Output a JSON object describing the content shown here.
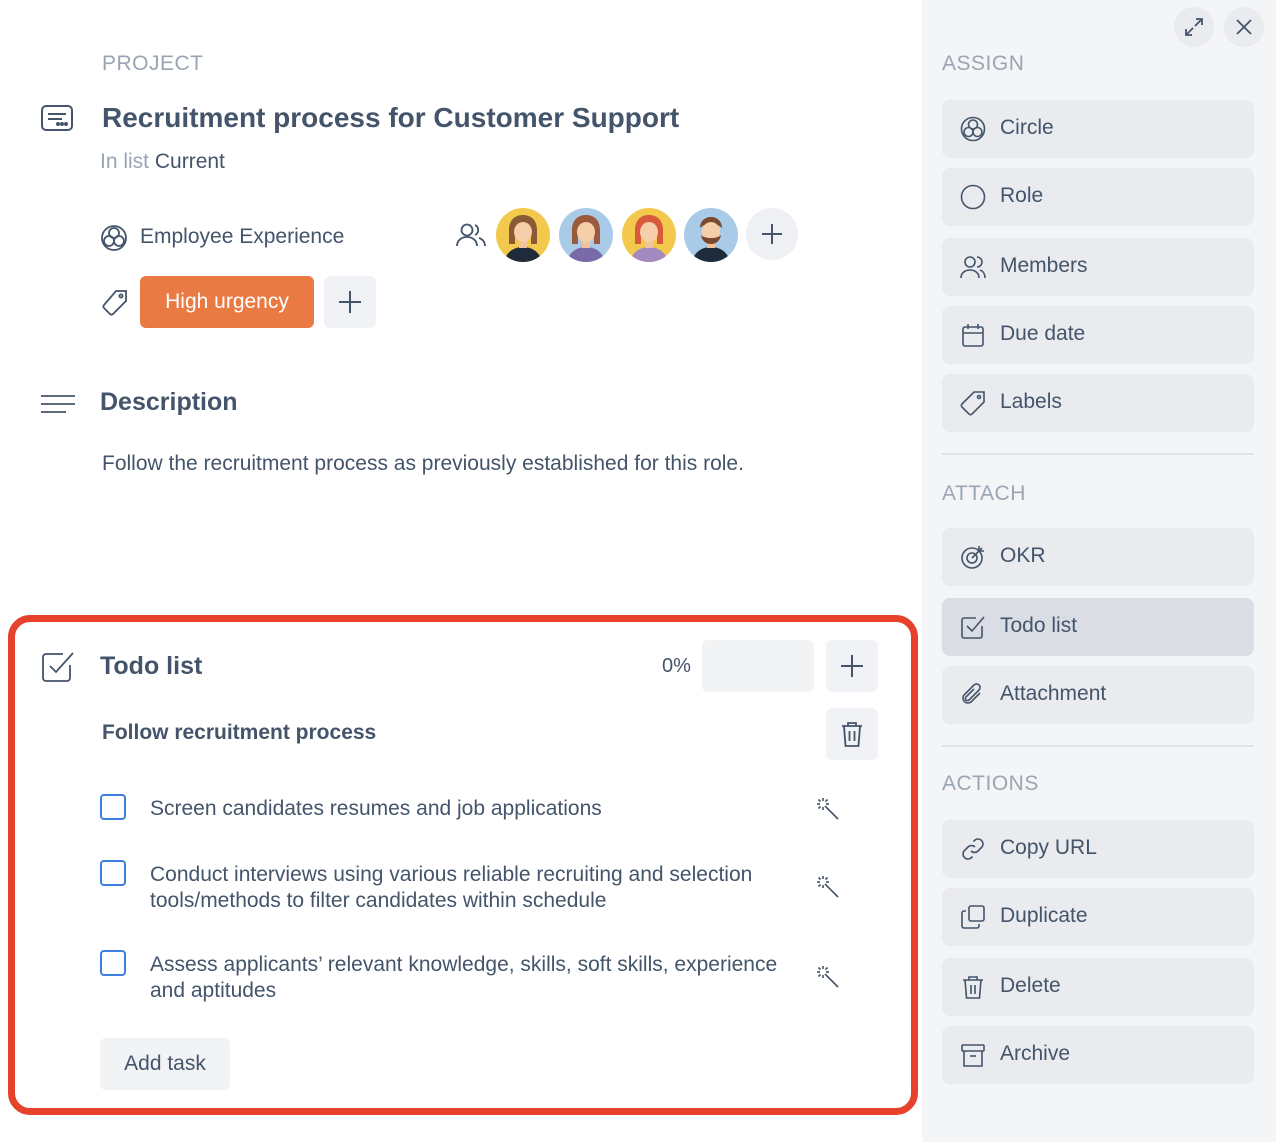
{
  "card": {
    "kicker": "PROJECT",
    "title": "Recruitment process for Customer Support",
    "in_list_prefix": "In list",
    "in_list_value": "Current",
    "circle_name": "Employee Experience",
    "label": "High urgency",
    "label_color": "#e97a43"
  },
  "members": [
    {
      "name": "member-1",
      "bg": "#f3c94d",
      "hair": "#8a5a34",
      "shirt": "#1f2a3a"
    },
    {
      "name": "member-2",
      "bg": "#a9cbe8",
      "hair": "#9c5a3c",
      "shirt": "#7a69a8"
    },
    {
      "name": "member-3",
      "bg": "#f3c94d",
      "hair": "#d9593b",
      "shirt": "#a08ac0"
    },
    {
      "name": "member-4",
      "bg": "#a9cbe8",
      "hair": "#7a4a2e",
      "shirt": "#1f2a3a"
    }
  ],
  "description": {
    "heading": "Description",
    "text": "Follow the recruitment process as previously established for this role."
  },
  "todo": {
    "heading": "Todo list",
    "progress_text": "0%",
    "progress_value": 0,
    "checklist_name": "Follow recruitment process",
    "tasks": [
      {
        "text": "Screen candidates resumes and job applications",
        "checked": false
      },
      {
        "text": "Conduct interviews using various reliable recruiting and selection tools/methods to filter candidates within schedule",
        "checked": false
      },
      {
        "text": "Assess applicants’ relevant knowledge, skills, soft skills, experience and aptitudes",
        "checked": false
      }
    ],
    "add_task_label": "Add task"
  },
  "sidebar": {
    "assign_heading": "ASSIGN",
    "assign": [
      {
        "label": "Circle",
        "icon": "circle-group-icon"
      },
      {
        "label": "Role",
        "icon": "role-icon"
      },
      {
        "label": "Members",
        "icon": "members-icon"
      },
      {
        "label": "Due date",
        "icon": "calendar-icon"
      },
      {
        "label": "Labels",
        "icon": "tag-icon"
      }
    ],
    "attach_heading": "ATTACH",
    "attach": [
      {
        "label": "OKR",
        "icon": "target-icon"
      },
      {
        "label": "Todo list",
        "icon": "checkbox-icon",
        "active": true
      },
      {
        "label": "Attachment",
        "icon": "paperclip-icon"
      }
    ],
    "actions_heading": "ACTIONS",
    "actions": [
      {
        "label": "Copy URL",
        "icon": "link-icon"
      },
      {
        "label": "Duplicate",
        "icon": "duplicate-icon"
      },
      {
        "label": "Delete",
        "icon": "trash-icon"
      },
      {
        "label": "Archive",
        "icon": "archive-icon"
      }
    ]
  },
  "colors": {
    "text": "#44546a",
    "muted": "#9aa4b2",
    "highlight": "#e5412b",
    "checkbox": "#3d7fe0",
    "sidebar_bg": "#f4f5f7"
  }
}
